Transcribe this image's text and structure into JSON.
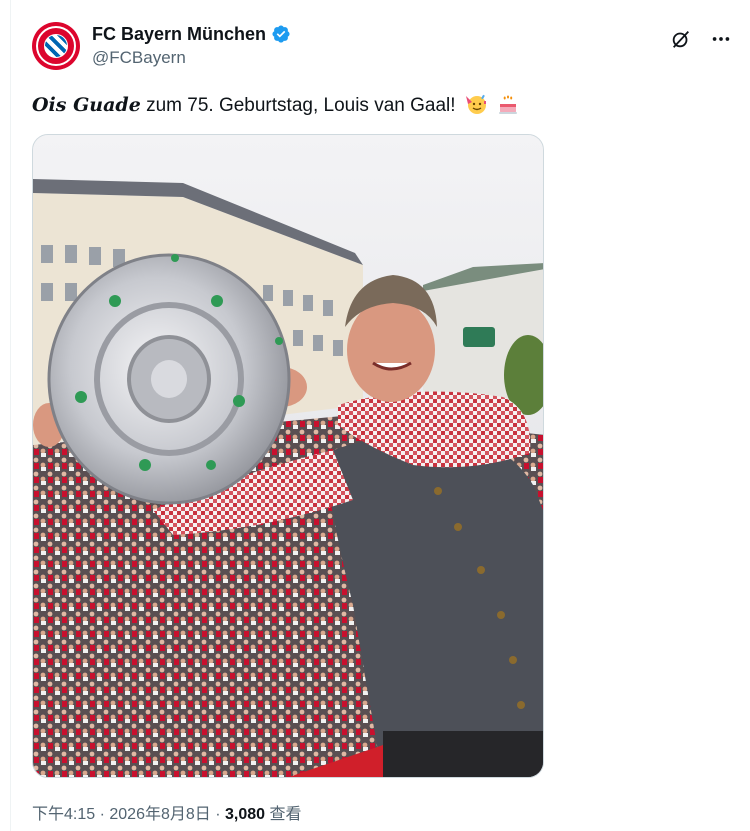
{
  "account": {
    "display_name": "FC Bayern München",
    "handle": "@FCBayern",
    "verified": true,
    "avatar_icon": "fc-bayern-logo-icon"
  },
  "actions": {
    "grok_icon": "slash-circle-icon",
    "more_icon": "more-dots-icon"
  },
  "tweet": {
    "text_bold_italic": "Ois Guade",
    "text_rest": " zum 75. Geburtstag, Louis van Gaal!",
    "emojis": [
      "party-face-emoji",
      "birthday-cake-emoji"
    ]
  },
  "media": {
    "type": "photo",
    "icon": "photo-louis-van-gaal-trophy"
  },
  "meta": {
    "time": "下午4:15",
    "separator": " · ",
    "date": "2026年8月8日",
    "views_count": "3,080",
    "views_label": " 查看"
  },
  "colors": {
    "brand_red": "#dc052d",
    "verified_blue": "#1d9bf0",
    "muted_text": "#536471"
  }
}
